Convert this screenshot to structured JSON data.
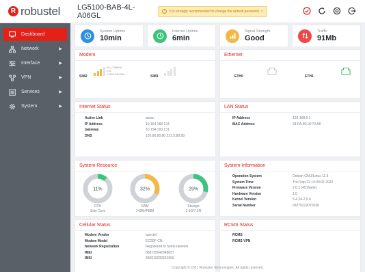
{
  "header": {
    "brand": "robustel",
    "model": "LG5100-BAB-4L-A06GL",
    "warning": "It is strongly recommended to change the default password",
    "icons": [
      "alert-icon",
      "refresh-icon",
      "settings-icon",
      "logout-icon"
    ],
    "accent": "#e2231a"
  },
  "sidebar": {
    "items": [
      {
        "label": "Dashboard",
        "icon": "dashboard-icon",
        "active": true
      },
      {
        "label": "Network",
        "icon": "network-icon",
        "arrow": "▶"
      },
      {
        "label": "Interface",
        "icon": "interface-icon",
        "arrow": "▶"
      },
      {
        "label": "VPN",
        "icon": "vpn-icon",
        "arrow": "▶"
      },
      {
        "label": "Services",
        "icon": "services-icon",
        "arrow": "▶"
      },
      {
        "label": "System",
        "icon": "system-icon",
        "arrow": "▶"
      }
    ]
  },
  "stats": [
    {
      "label": "System Uptime",
      "value": "10min",
      "color": "#2f8fe0"
    },
    {
      "label": "Internet Uptime",
      "value": "6min",
      "color": "#3cc47c"
    },
    {
      "label": "Signal Strength",
      "value": "Good",
      "color": "#f3b84a"
    },
    {
      "label": "Traffic",
      "value": "91Mb",
      "color": "#ec4a4a"
    }
  ],
  "modem": {
    "title": "Modem",
    "sim2": {
      "label": "SIM2",
      "info": [
        "26 (-76dBm)",
        "LTE",
        "CHN-UNICOM"
      ],
      "level": 3
    },
    "sim1": {
      "label": "SIM1",
      "level": 0
    }
  },
  "ethernet": {
    "title": "Ethernet",
    "ports": [
      {
        "label": "ETH0",
        "connected": false
      },
      {
        "label": "ETH1",
        "connected": true
      }
    ]
  },
  "internet_status": {
    "title": "Internet Status",
    "rows": [
      {
        "k": "Active Link",
        "v": "wwan"
      },
      {
        "k": "IP Address",
        "v": "10.154.183.124"
      },
      {
        "k": "Gateway",
        "v": "10.154.183.131"
      },
      {
        "k": "DNS",
        "v": "120.80.80.80 221.5.88.88"
      }
    ]
  },
  "lan_status": {
    "title": "LAN Status",
    "rows": [
      {
        "k": "IP Address",
        "v": "192.168.0.1"
      },
      {
        "k": "MAC Address",
        "v": "34:FA:40:18:70:A6"
      }
    ]
  },
  "system_resource": {
    "title": "System Resource",
    "items": [
      {
        "pct": 11,
        "pct_label": "11%",
        "label": "CPU",
        "sub": "Sole Core",
        "color": "#3cc47c"
      },
      {
        "pct": 32,
        "pct_label": "32%",
        "label": "RAM",
        "sub": "143M/448M",
        "color": "#f3b84a"
      },
      {
        "pct": 29,
        "pct_label": "29%",
        "label": "Storage",
        "sub": "2.1G/7.2G",
        "color": "#3cc47c"
      }
    ]
  },
  "system_information": {
    "title": "System Information",
    "rows": [
      {
        "k": "Operation System",
        "v": "Debian GNU/Linux 11.5"
      },
      {
        "k": "System Time",
        "v": "Thu Sep 22 14:39:02 2022"
      },
      {
        "k": "Firmware Version",
        "v": "2.0.1 (4515a0e)"
      },
      {
        "k": "Hardware Version",
        "v": "1.0"
      },
      {
        "k": "Kernel Version",
        "v": "5.4.24-2.0.0"
      },
      {
        "k": "Serial Number",
        "v": "09270222070036"
      }
    ]
  },
  "cellular_status": {
    "title": "Cellular Status",
    "rows": [
      {
        "k": "Modem Vendor",
        "v": "quectel"
      },
      {
        "k": "Modem Model",
        "v": "EC20F-CN"
      },
      {
        "k": "Network Registration",
        "v": "Registered to home network"
      },
      {
        "k": "IMEI",
        "v": "868735042848657"
      },
      {
        "k": "IMSI",
        "v": "460010232631650"
      }
    ]
  },
  "rcms_status": {
    "title": "RCMS Status",
    "rows": [
      {
        "k": "RCMS",
        "v": ""
      },
      {
        "k": "RCMS VPN",
        "v": ""
      }
    ]
  },
  "footer": "Copyright © 2021 Robustel Technologies. All rights reserved."
}
